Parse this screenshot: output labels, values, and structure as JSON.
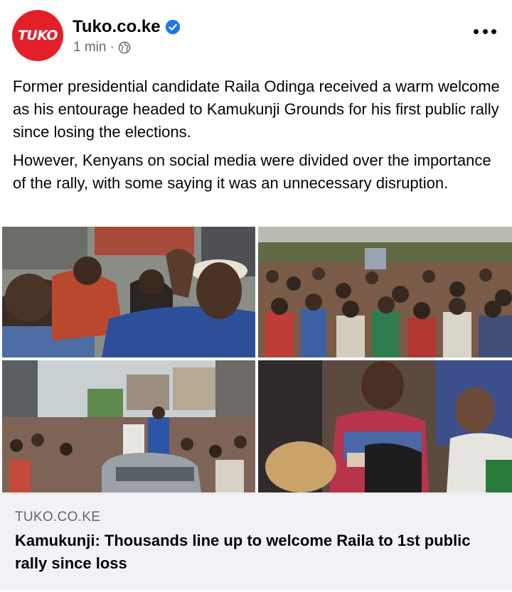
{
  "post": {
    "avatar_text": "TUKO",
    "page_name": "Tuko.co.ke",
    "time": "1 min",
    "separator": "·",
    "paragraphs": [
      "Former presidential candidate Raila Odinga received a warm welcome as his entourage headed to Kamukunji Grounds for his first public rally since losing the elections.",
      "However, Kenyans on social media were divided over the importance of the rally, with some saying it was an unnecessary disruption."
    ]
  },
  "link_preview": {
    "domain": "TUKO.CO.KE",
    "title": "Kamukunji: Thousands line up to welcome Raila to 1st public rally since loss"
  },
  "icons": {
    "verified": "verified-badge-icon",
    "audience": "globe-icon",
    "more": "more-options-icon"
  },
  "colors": {
    "brand": "#e3202a",
    "verified": "#1877f2",
    "secondary_text": "#65676b",
    "link_box_bg": "#f0f2f5"
  }
}
